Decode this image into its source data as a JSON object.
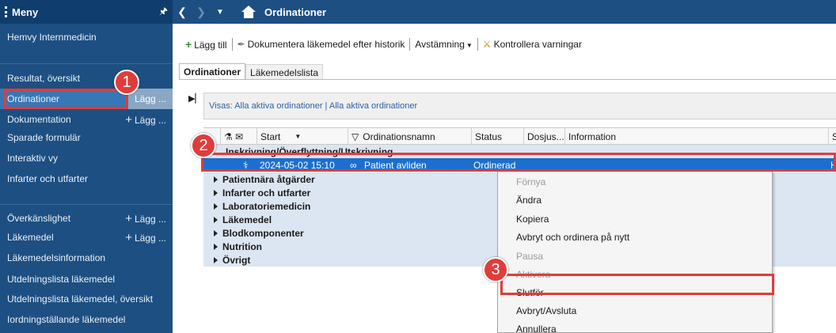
{
  "sidebar": {
    "title": "Meny",
    "items": [
      {
        "label": "Hemvy Internmedicin",
        "add": ""
      },
      {
        "label": "Resultat, översikt",
        "add": ""
      },
      {
        "label": "Ordinationer",
        "add": "Lägg ..."
      },
      {
        "label": "Dokumentation",
        "add": "Lägg ..."
      },
      {
        "label": "Sparade formulär",
        "add": ""
      },
      {
        "label": "Interaktiv vy",
        "add": ""
      },
      {
        "label": "Infarter och utfarter",
        "add": ""
      },
      {
        "label": "Överkänslighet",
        "add": "Lägg ..."
      },
      {
        "label": "Läkemedel",
        "add": "Lägg ..."
      },
      {
        "label": "Läkemedelsinformation",
        "add": ""
      },
      {
        "label": "Utdelningslista läkemedel",
        "add": ""
      },
      {
        "label": "Utdelningslista läkemedel, översikt",
        "add": ""
      },
      {
        "label": "Iordningställande läkemedel",
        "add": ""
      }
    ]
  },
  "topbar": {
    "title": "Ordinationer"
  },
  "toolbar": {
    "add": "Lägg till",
    "document": "Dokumentera läkemedel efter historik",
    "reconcile": "Avstämning",
    "check": "Kontrollera varningar"
  },
  "tabs": {
    "active": "Ordinationer",
    "inactive": "Läkemedelslista"
  },
  "filter": {
    "text": "Visas: Alla aktiva ordinationer | Alla aktiva ordinationer"
  },
  "grid": {
    "columns": {
      "start": "Start",
      "name": "Ordinationsnamn",
      "status": "Status",
      "dose": "Dosjus...",
      "info": "Information",
      "last": "S"
    },
    "groups": [
      "Inskrivning/Överflyttning/Utskrivning",
      "Patientnära åtgärder",
      "Infarter och utfarter",
      "Laboratoriemedicin",
      "Läkemedel",
      "Blodkomponenter",
      "Nutrition",
      "Övrigt"
    ],
    "selected_row": {
      "start": "2024-05-02 15:10",
      "name": "Patient avliden",
      "status": "Ordinerad",
      "last": "H"
    }
  },
  "context_menu": {
    "items": [
      {
        "label": "Förnya",
        "disabled": true
      },
      {
        "label": "Ändra",
        "disabled": false
      },
      {
        "label": "Kopiera",
        "disabled": false
      },
      {
        "label": "Avbryt och ordinera på nytt",
        "disabled": false
      },
      {
        "label": "Pausa",
        "disabled": true
      },
      {
        "label": "Aktivera",
        "disabled": true
      },
      {
        "label": "Slutför",
        "disabled": false
      },
      {
        "label": "Avbryt/Avsluta",
        "disabled": false
      },
      {
        "label": "Annullera",
        "disabled": false
      }
    ]
  },
  "annotations": {
    "step1": "1",
    "step2": "2",
    "step3": "3"
  },
  "colors": {
    "highlight": "#e03c3c",
    "sidebar": "#1d4f82",
    "selection": "#1c6fcf"
  }
}
